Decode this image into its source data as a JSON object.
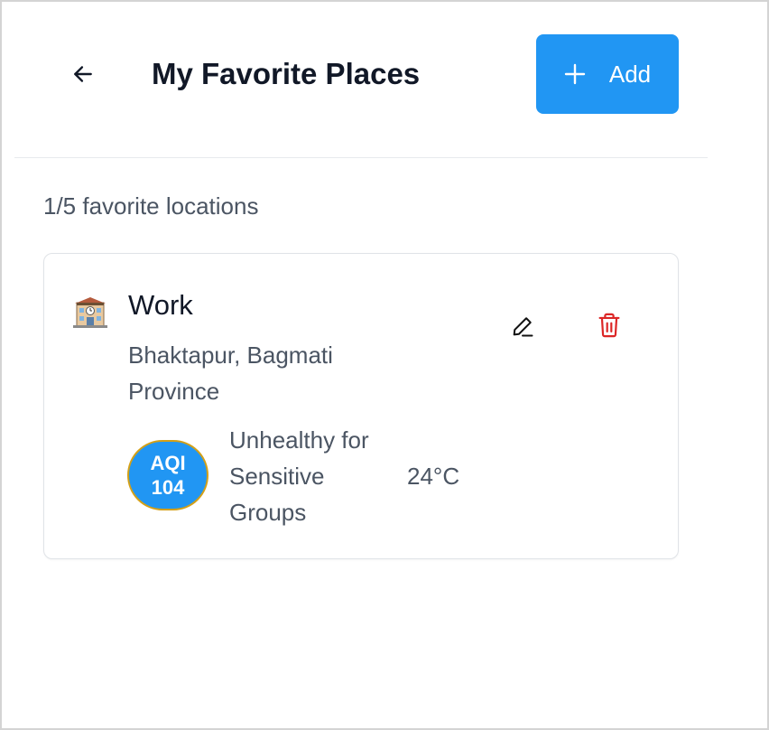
{
  "header": {
    "back_icon": "arrow-left-icon",
    "title": "My Favorite Places",
    "add_button": {
      "icon": "plus-icon",
      "label": "Add"
    }
  },
  "summary": {
    "count_text": "1/5 favorite locations"
  },
  "places": [
    {
      "icon": "building-icon",
      "name": "Work",
      "address": "Bhaktapur, Bagmati Province",
      "edit_icon": "pencil-icon",
      "delete_icon": "trash-icon",
      "aqi": {
        "label": "AQI",
        "value": "104",
        "status": "Unhealthy for Sensitive Groups",
        "badge_color": "#2196f3",
        "border_color": "#d4a017"
      },
      "temperature": "24°C"
    }
  ],
  "colors": {
    "accent": "#2196f3",
    "delete": "#dc2626",
    "text_primary": "#111827",
    "text_secondary": "#4b5563"
  }
}
